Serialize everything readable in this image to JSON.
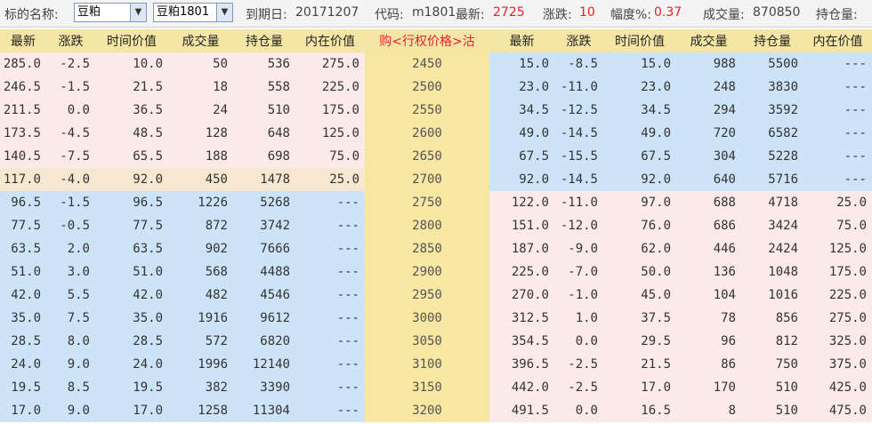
{
  "header": {
    "name_label": "标的名称:",
    "underlying_value": "豆粕",
    "contract_value": "豆粕1801",
    "expiry_label": "到期日:",
    "expiry_value": "20171207",
    "code_label": "代码:",
    "code_value": "m1801",
    "last_label": "最新:",
    "last_value": "2725",
    "change_label": "涨跌:",
    "change_value": "10",
    "pct_label": "幅度%:",
    "pct_value": "0.37",
    "volume_label": "成交量:",
    "volume_value": "870850",
    "oi_label": "持仓量:"
  },
  "columns": {
    "left": [
      "最新",
      "涨跌",
      "时间价值",
      "成交量",
      "持仓量",
      "内在价值"
    ],
    "strike": "购<行权价格>沽",
    "right": [
      "最新",
      "涨跌",
      "时间价值",
      "成交量",
      "持仓量",
      "内在价值"
    ]
  },
  "colors": {
    "header_bg": "#f5e6a6",
    "pink": "#fce9ea",
    "blue": "#cde3f8",
    "tan": "#f8e8d2",
    "red": "#e8202c",
    "green": "#0a8a1a"
  },
  "rows": [
    {
      "strike": "2450",
      "call": [
        "285.0",
        "-2.5",
        "10.0",
        "50",
        "536",
        "275.0"
      ],
      "put": [
        "15.0",
        "-8.5",
        "15.0",
        "988",
        "5500",
        "---"
      ]
    },
    {
      "strike": "2500",
      "call": [
        "246.5",
        "-1.5",
        "21.5",
        "18",
        "558",
        "225.0"
      ],
      "put": [
        "23.0",
        "-11.0",
        "23.0",
        "248",
        "3830",
        "---"
      ]
    },
    {
      "strike": "2550",
      "call": [
        "211.5",
        "0.0",
        "36.5",
        "24",
        "510",
        "175.0"
      ],
      "put": [
        "34.5",
        "-12.5",
        "34.5",
        "294",
        "3592",
        "---"
      ]
    },
    {
      "strike": "2600",
      "call": [
        "173.5",
        "-4.5",
        "48.5",
        "128",
        "648",
        "125.0"
      ],
      "put": [
        "49.0",
        "-14.5",
        "49.0",
        "720",
        "6582",
        "---"
      ]
    },
    {
      "strike": "2650",
      "call": [
        "140.5",
        "-7.5",
        "65.5",
        "188",
        "698",
        "75.0"
      ],
      "put": [
        "67.5",
        "-15.5",
        "67.5",
        "304",
        "5228",
        "---"
      ]
    },
    {
      "strike": "2700",
      "call": [
        "117.0",
        "-4.0",
        "92.0",
        "450",
        "1478",
        "25.0"
      ],
      "put": [
        "92.0",
        "-14.5",
        "92.0",
        "640",
        "5716",
        "---"
      ]
    },
    {
      "strike": "2750",
      "call": [
        "96.5",
        "-1.5",
        "96.5",
        "1226",
        "5268",
        "---"
      ],
      "put": [
        "122.0",
        "-11.0",
        "97.0",
        "688",
        "4718",
        "25.0"
      ]
    },
    {
      "strike": "2800",
      "call": [
        "77.5",
        "-0.5",
        "77.5",
        "872",
        "3742",
        "---"
      ],
      "put": [
        "151.0",
        "-12.0",
        "76.0",
        "686",
        "3424",
        "75.0"
      ]
    },
    {
      "strike": "2850",
      "call": [
        "63.5",
        "2.0",
        "63.5",
        "902",
        "7666",
        "---"
      ],
      "put": [
        "187.0",
        "-9.0",
        "62.0",
        "446",
        "2424",
        "125.0"
      ]
    },
    {
      "strike": "2900",
      "call": [
        "51.0",
        "3.0",
        "51.0",
        "568",
        "4488",
        "---"
      ],
      "put": [
        "225.0",
        "-7.0",
        "50.0",
        "136",
        "1048",
        "175.0"
      ]
    },
    {
      "strike": "2950",
      "call": [
        "42.0",
        "5.5",
        "42.0",
        "482",
        "4546",
        "---"
      ],
      "put": [
        "270.0",
        "-1.0",
        "45.0",
        "104",
        "1016",
        "225.0"
      ]
    },
    {
      "strike": "3000",
      "call": [
        "35.0",
        "7.5",
        "35.0",
        "1916",
        "9612",
        "---"
      ],
      "put": [
        "312.5",
        "1.0",
        "37.5",
        "78",
        "856",
        "275.0"
      ]
    },
    {
      "strike": "3050",
      "call": [
        "28.5",
        "8.0",
        "28.5",
        "572",
        "6820",
        "---"
      ],
      "put": [
        "354.5",
        "0.0",
        "29.5",
        "96",
        "812",
        "325.0"
      ]
    },
    {
      "strike": "3100",
      "call": [
        "24.0",
        "9.0",
        "24.0",
        "1996",
        "12140",
        "---"
      ],
      "put": [
        "396.5",
        "-2.5",
        "21.5",
        "86",
        "750",
        "375.0"
      ]
    },
    {
      "strike": "3150",
      "call": [
        "19.5",
        "8.5",
        "19.5",
        "382",
        "3390",
        "---"
      ],
      "put": [
        "442.0",
        "-2.5",
        "17.0",
        "170",
        "510",
        "425.0"
      ]
    },
    {
      "strike": "3200",
      "call": [
        "17.0",
        "9.0",
        "17.0",
        "1258",
        "11304",
        "---"
      ],
      "put": [
        "491.5",
        "0.0",
        "16.5",
        "8",
        "510",
        "475.0"
      ]
    }
  ]
}
